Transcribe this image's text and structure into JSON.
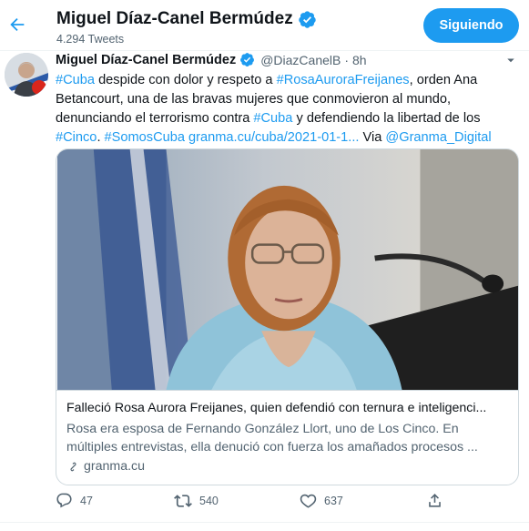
{
  "header": {
    "name": "Miguel Díaz-Canel Bermúdez",
    "tweet_count": "4.294 Tweets",
    "follow_label": "Siguiendo"
  },
  "tweet": {
    "author": "Miguel Díaz-Canel Bermúdez",
    "handle": "@DiazCanelB",
    "dot": "·",
    "time": "8h",
    "segments": [
      {
        "t": "#Cuba",
        "link": true
      },
      {
        "t": " despide con dolor y respeto a ",
        "link": false
      },
      {
        "t": "#RosaAuroraFreijanes",
        "link": true
      },
      {
        "t": ", orden Ana Betancourt, una de las bravas mujeres que conmovieron al mundo, denunciando  el terrorismo contra ",
        "link": false
      },
      {
        "t": "#Cuba",
        "link": true
      },
      {
        "t": " y defendiendo la libertad de los ",
        "link": false
      },
      {
        "t": "#Cinco",
        "link": true
      },
      {
        "t": ". ",
        "link": false
      },
      {
        "t": "#SomosCuba",
        "link": true
      },
      {
        "t": " ",
        "link": false
      },
      {
        "t": "granma.cu/cuba/2021-01-1...",
        "link": true
      },
      {
        "t": " Via ",
        "link": false
      },
      {
        "t": "@Granma_Digital",
        "link": true
      }
    ]
  },
  "card": {
    "title": "Falleció Rosa Aurora Freijanes, quien defendió con ternura e inteligenci...",
    "description": "Rosa era esposa de Fernando González Llort, uno de Los Cinco. En múltiples entrevistas, ella denució con fuerza los amañados procesos ...",
    "domain": "granma.cu"
  },
  "actions": {
    "replies": "47",
    "retweets": "540",
    "likes": "637"
  },
  "colors": {
    "accent": "#1d9bf0",
    "secondary_text": "#536471",
    "border": "#cfd9de"
  }
}
